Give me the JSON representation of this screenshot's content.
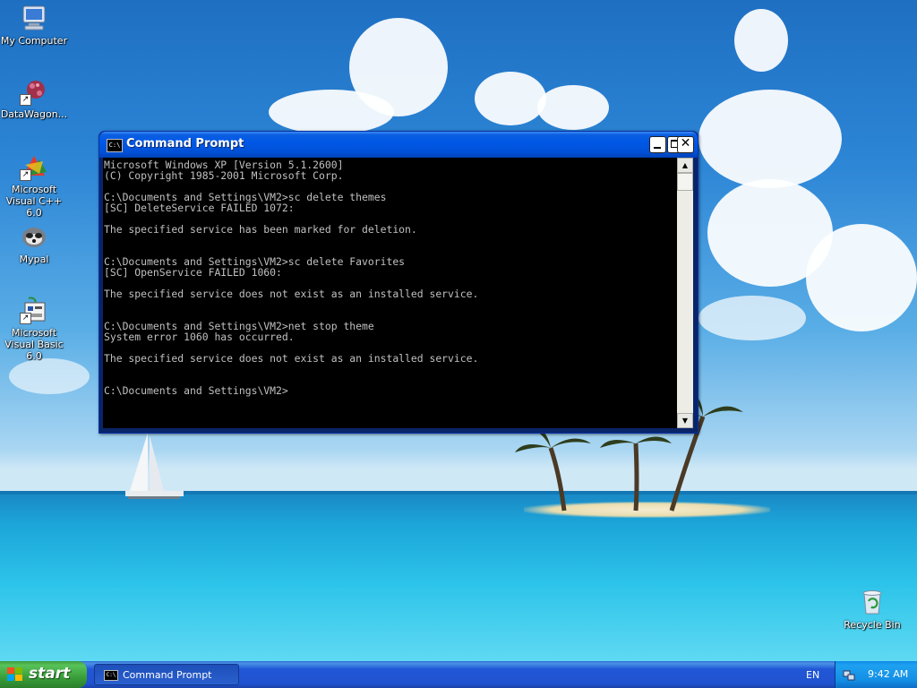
{
  "desktop": {
    "icons": [
      {
        "label": "My Computer",
        "icon": "my-computer-icon"
      },
      {
        "label": "DataWagon...",
        "icon": "datawagon-icon"
      },
      {
        "label": "Microsoft Visual C++ 6.0",
        "icon": "visual-cpp-icon"
      },
      {
        "label": "Mypal",
        "icon": "mypal-icon"
      },
      {
        "label": "Microsoft Visual Basic 6.0",
        "icon": "visual-basic-icon"
      },
      {
        "label": "Recycle Bin",
        "icon": "recycle-bin-icon"
      }
    ]
  },
  "window": {
    "title": "Command Prompt",
    "icon_text": "C:\\",
    "console_lines": [
      "Microsoft Windows XP [Version 5.1.2600]",
      "(C) Copyright 1985-2001 Microsoft Corp.",
      "",
      "C:\\Documents and Settings\\VM2>sc delete themes",
      "[SC] DeleteService FAILED 1072:",
      "",
      "The specified service has been marked for deletion.",
      "",
      "",
      "C:\\Documents and Settings\\VM2>sc delete Favorites",
      "[SC] OpenService FAILED 1060:",
      "",
      "The specified service does not exist as an installed service.",
      "",
      "",
      "C:\\Documents and Settings\\VM2>net stop theme",
      "System error 1060 has occurred.",
      "",
      "The specified service does not exist as an installed service.",
      "",
      "",
      "C:\\Documents and Settings\\VM2>"
    ]
  },
  "taskbar": {
    "start_label": "start",
    "task_label": "Command Prompt",
    "language": "EN",
    "clock": "9:42 AM"
  },
  "colors": {
    "taskbar_blue": "#245edb",
    "start_green": "#3a9f3a",
    "console_bg": "#000000",
    "console_fg": "#c0c0c0"
  }
}
